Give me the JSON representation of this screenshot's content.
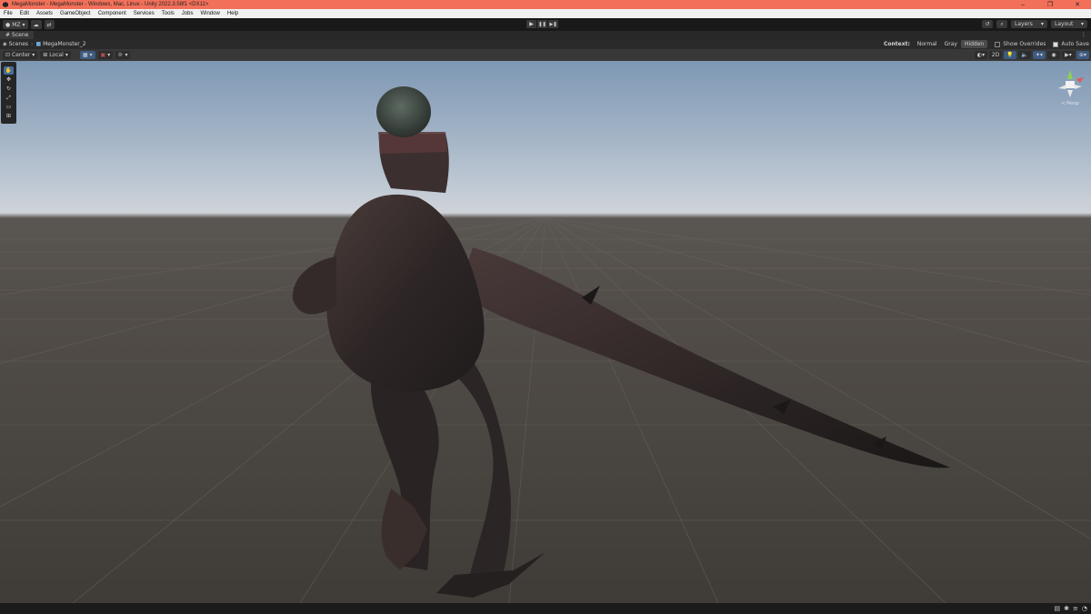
{
  "window": {
    "title": "MegaMonster - MegaMonster - Windows, Mac, Linux - Unity 2022.3.58f1 <DX11>",
    "controls": [
      "–",
      "❐",
      "✕"
    ]
  },
  "menu": [
    "File",
    "Edit",
    "Assets",
    "GameObject",
    "Component",
    "Services",
    "Tools",
    "Jobs",
    "Window",
    "Help"
  ],
  "toolbar": {
    "account_label": "MZ",
    "play_icons": [
      "▶",
      "❚❚",
      "▶❚"
    ],
    "layers_label": "Layers",
    "layout_label": "Layout"
  },
  "scene_tab": {
    "label": "Scene",
    "menu_icon": "⋮"
  },
  "breadcrumb": {
    "root": "Scenes",
    "current": "MegaMonster_2"
  },
  "context": {
    "label": "Context:",
    "options": [
      "Normal",
      "Gray",
      "Hidden"
    ],
    "selected": "Hidden",
    "show_overrides_label": "Show Overrides",
    "show_overrides_checked": false,
    "auto_save_label": "Auto Save",
    "auto_save_checked": true
  },
  "scene_toolbar": {
    "pivot_label": "Center",
    "space_label": "Local",
    "mode_2d_label": "2D"
  },
  "gizmo": {
    "projection_label": "≺ Persp"
  },
  "colors": {
    "title_bar": "#f2705a",
    "accent": "#3f6fa3"
  }
}
